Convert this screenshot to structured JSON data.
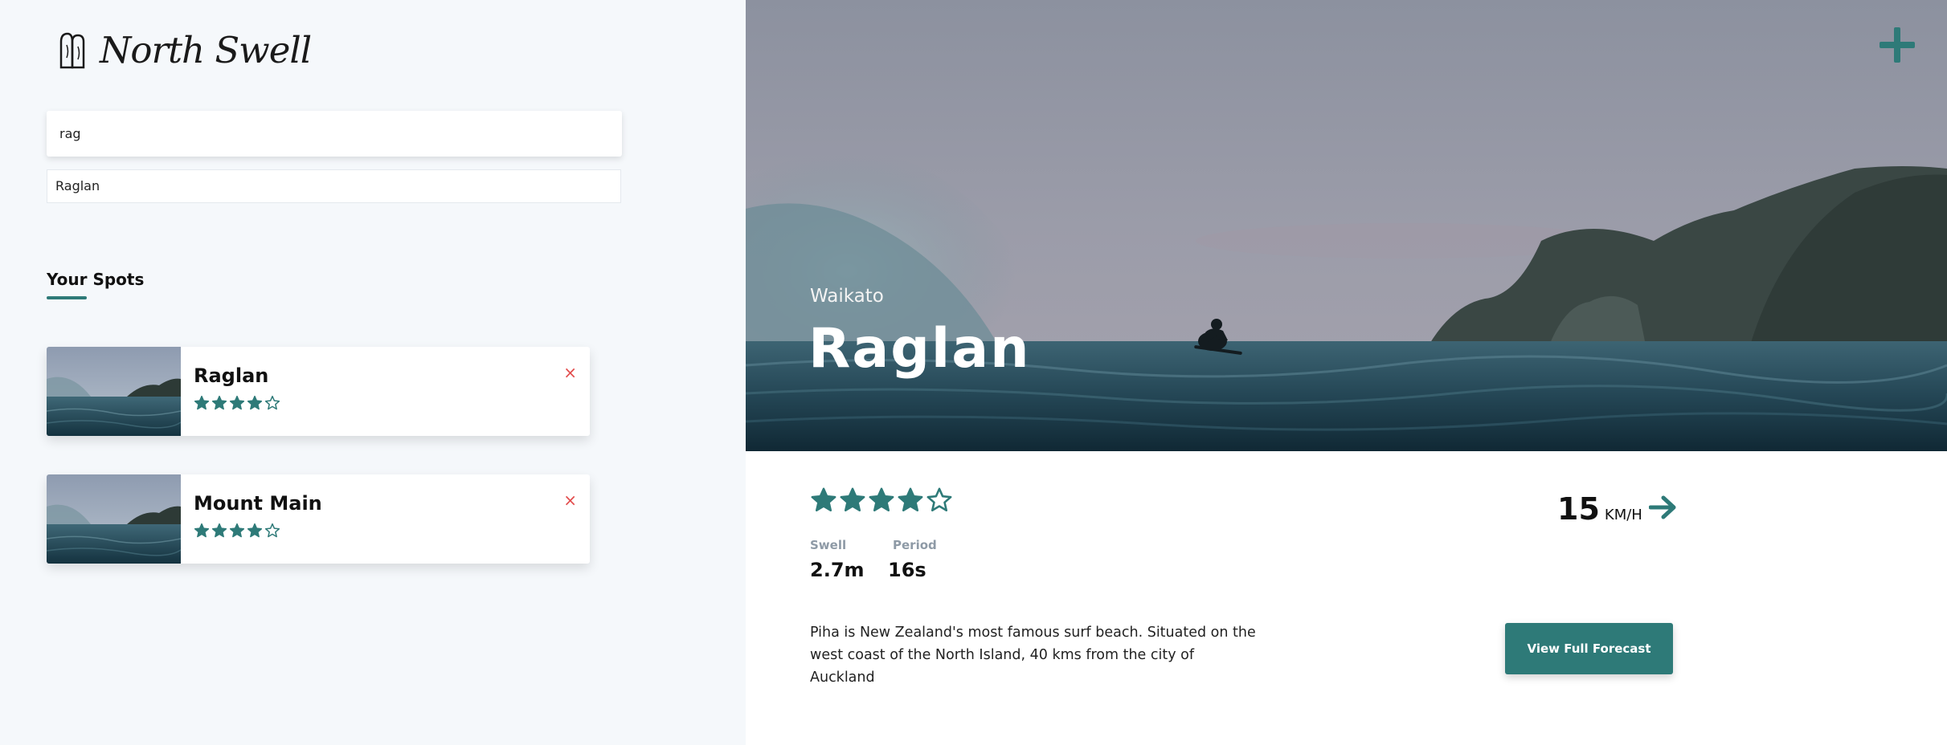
{
  "app": {
    "name": "North Swell"
  },
  "search": {
    "value": "rag"
  },
  "suggestions": [
    "Raglan"
  ],
  "spots": {
    "heading": "Your Spots",
    "items": [
      {
        "name": "Raglan",
        "rating": 4,
        "remove": "×"
      },
      {
        "name": "Mount Main",
        "rating": 4,
        "remove": "×"
      }
    ]
  },
  "hero": {
    "region": "Waikato",
    "title": "Raglan",
    "add_icon": "plus-icon"
  },
  "details": {
    "rating": 4,
    "rating_max": 5,
    "wind": {
      "value": "15",
      "unit": "KM/H"
    },
    "swell": {
      "label": "Swell",
      "value": "2.7m"
    },
    "period": {
      "label": "Period",
      "value": "16s"
    },
    "description": "Piha is New Zealand's most famous surf beach. Situated on the west coast of the North Island, 40 kms from the city of Auckland",
    "forecast_button": "View Full Forecast"
  },
  "colors": {
    "accent": "#2e7a78",
    "remove": "#e24b4b",
    "panel_bg": "#f5f8fb"
  }
}
